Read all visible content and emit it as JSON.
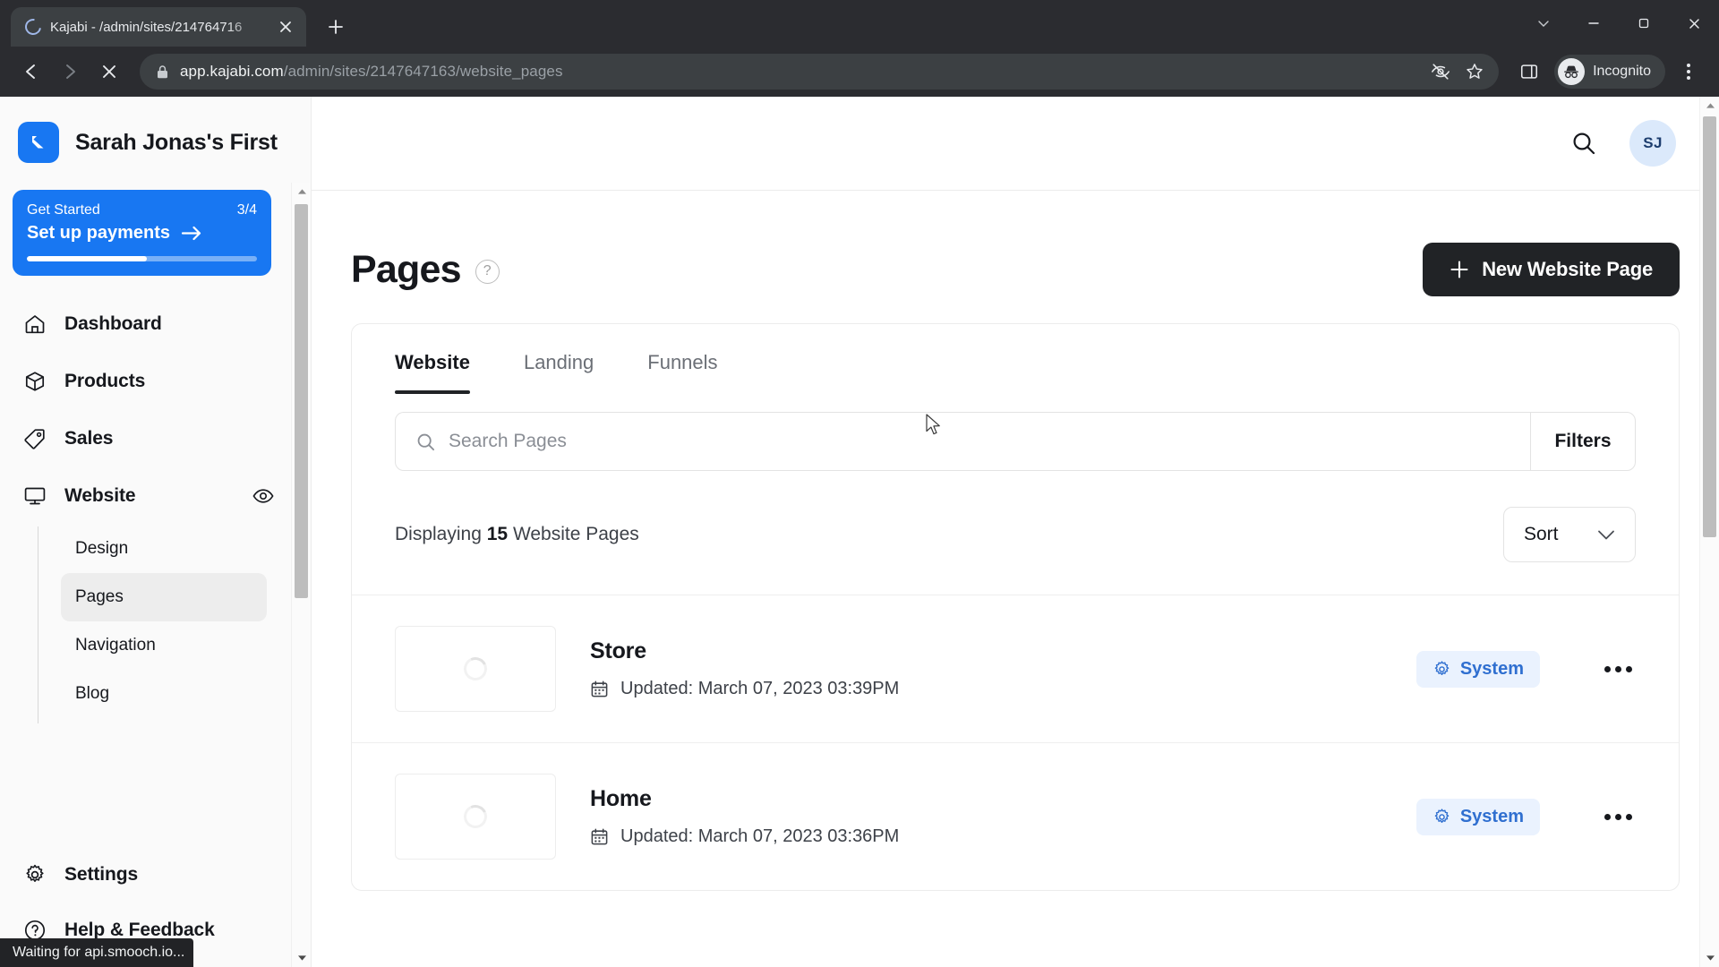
{
  "browser": {
    "tab": {
      "title": "Kajabi - /admin/sites/214764716",
      "loading": true
    },
    "new_tab_label": "+",
    "url_prefix": "app.kajabi.com",
    "url_path": "/admin/sites/2147647163/website_pages",
    "profile_label": "Incognito",
    "status_text": "Waiting for api.smooch.io..."
  },
  "sidebar": {
    "brand": "Sarah Jonas's First",
    "get_started": {
      "label": "Get Started",
      "count": "3/4",
      "action": "Set up payments",
      "progress": 52
    },
    "items": [
      {
        "label": "Dashboard",
        "icon": "home-icon"
      },
      {
        "label": "Products",
        "icon": "box-icon"
      },
      {
        "label": "Sales",
        "icon": "tag-icon"
      },
      {
        "label": "Website",
        "icon": "monitor-icon",
        "trailing_icon": "eye-icon",
        "expanded": true
      }
    ],
    "subitems": [
      {
        "label": "Design",
        "active": false
      },
      {
        "label": "Pages",
        "active": true
      },
      {
        "label": "Navigation",
        "active": false
      },
      {
        "label": "Blog",
        "active": false
      }
    ],
    "bottom_items": [
      {
        "label": "Settings",
        "icon": "gear-icon"
      },
      {
        "label": "Help & Feedback",
        "icon": "question-circle-icon"
      }
    ]
  },
  "header": {
    "search_icon": "search-icon",
    "avatar_initials": "SJ"
  },
  "page": {
    "title": "Pages",
    "help_icon": "question-mark-icon",
    "new_button": "New Website Page",
    "new_button_icon": "plus-icon"
  },
  "tabs": [
    {
      "label": "Website",
      "active": true
    },
    {
      "label": "Landing",
      "active": false
    },
    {
      "label": "Funnels",
      "active": false
    }
  ],
  "search": {
    "placeholder": "Search Pages",
    "value": "",
    "icon": "search-icon",
    "filters_label": "Filters"
  },
  "listing": {
    "count_prefix": "Displaying",
    "count": "15",
    "count_suffix": "Website Pages",
    "sort_label": "Sort",
    "sort_icon": "chevron-down-icon"
  },
  "rows": [
    {
      "title": "Store",
      "updated": "Updated: March 07, 2023 03:39PM",
      "badge": "System",
      "badge_icon": "gear-icon",
      "menu_icon": "ellipsis-icon",
      "thumb_state": "loading"
    },
    {
      "title": "Home",
      "updated": "Updated: March 07, 2023 03:36PM",
      "badge": "System",
      "badge_icon": "gear-icon",
      "menu_icon": "ellipsis-icon",
      "thumb_state": "loading"
    }
  ],
  "colors": {
    "brand_blue": "#1877f2",
    "badge_bg": "#eaf2fe",
    "badge_text": "#2f6fd0",
    "dark_button": "#212326",
    "avatar_bg": "#dbe9fb"
  }
}
